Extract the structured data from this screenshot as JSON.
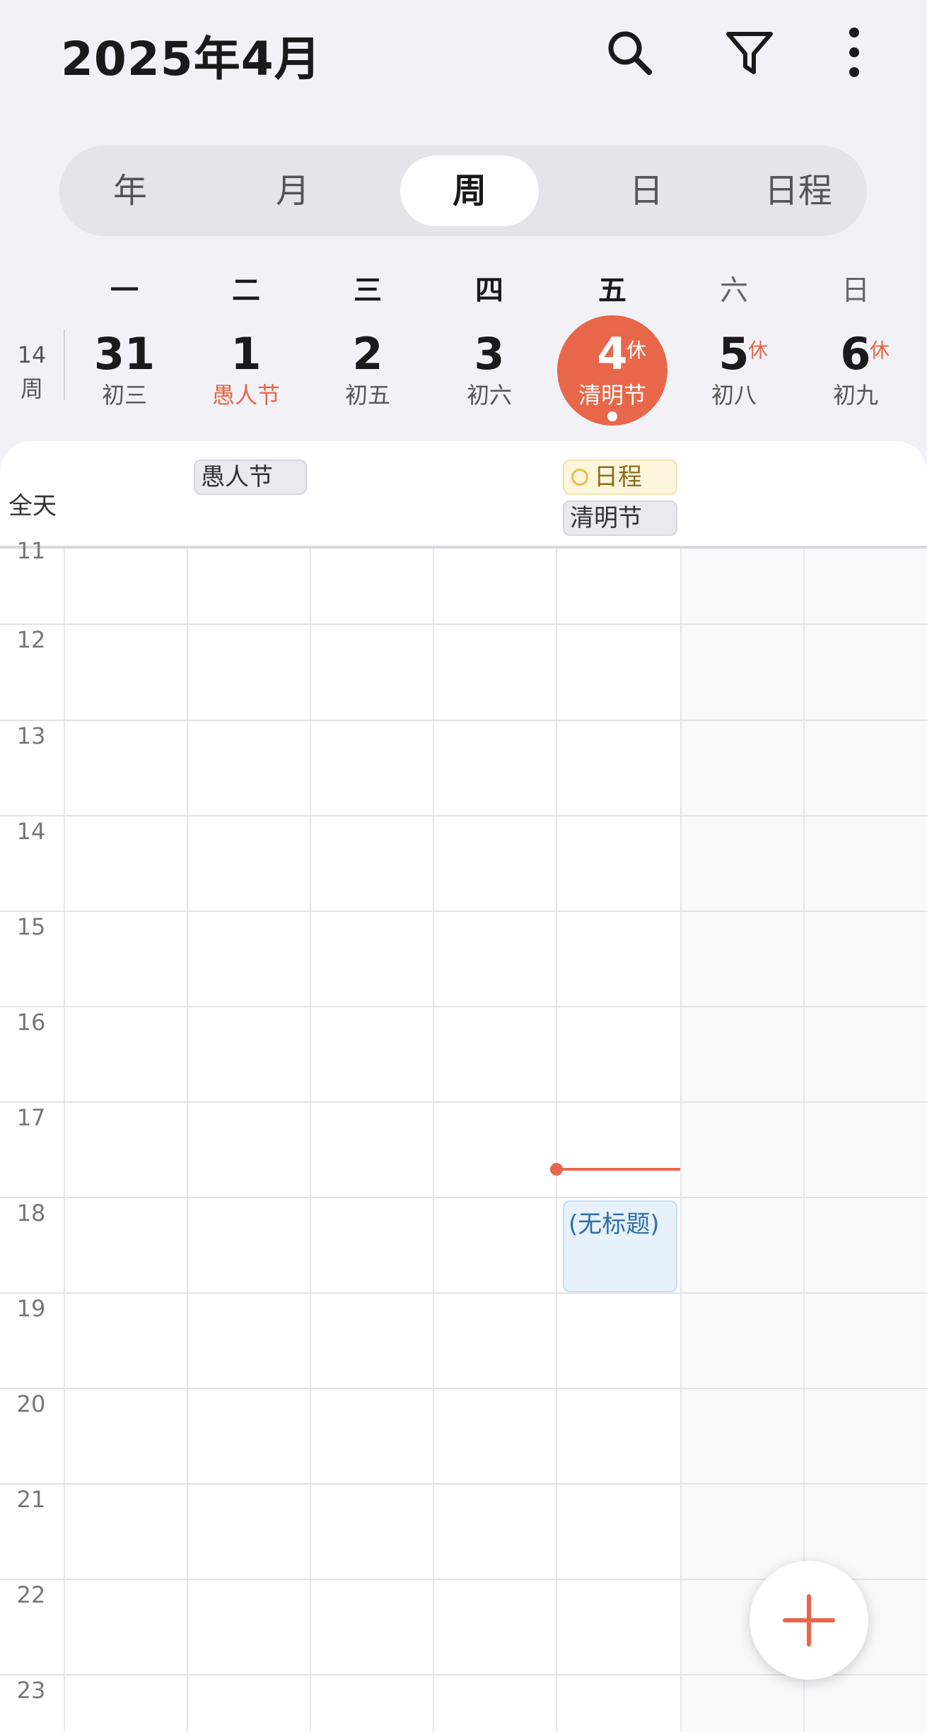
{
  "header": {
    "title": "2025年4月",
    "icons": [
      "search-icon",
      "filter-icon",
      "more-vertical-icon"
    ]
  },
  "view_tabs": [
    {
      "label": "年",
      "active": false
    },
    {
      "label": "月",
      "active": false
    },
    {
      "label": "周",
      "active": true
    },
    {
      "label": "日",
      "active": false
    },
    {
      "label": "日程",
      "active": false
    }
  ],
  "week": {
    "week_number": "14",
    "week_suffix": "周",
    "weekdays": [
      "一",
      "二",
      "三",
      "四",
      "五",
      "六",
      "日"
    ],
    "days": [
      {
        "date": "31",
        "lunar": "初三",
        "rest": ""
      },
      {
        "date": "1",
        "lunar": "愚人节",
        "rest": ""
      },
      {
        "date": "2",
        "lunar": "初五",
        "rest": ""
      },
      {
        "date": "3",
        "lunar": "初六",
        "rest": ""
      },
      {
        "date": "4",
        "lunar": "清明节",
        "rest": "休"
      },
      {
        "date": "5",
        "lunar": "初八",
        "rest": "休"
      },
      {
        "date": "6",
        "lunar": "初九",
        "rest": "休"
      }
    ]
  },
  "all_day": {
    "label": "全天",
    "events": [
      {
        "day": "二",
        "title": "愚人节"
      },
      {
        "day": "五",
        "title": "日程"
      },
      {
        "day": "五",
        "title": "清明节"
      }
    ]
  },
  "hours": [
    "11",
    "12",
    "13",
    "14",
    "15",
    "16",
    "17",
    "18",
    "19",
    "20",
    "21",
    "22",
    "23"
  ],
  "events": [
    {
      "day": "五",
      "title": "(无标题)"
    }
  ],
  "colors": {
    "accent": "#e8674a",
    "event_blue": "#e6f1fb",
    "event_text": "#2f6ea8",
    "chip_yellow": "#fdf5dc"
  },
  "fab": {
    "icon": "plus-icon"
  }
}
